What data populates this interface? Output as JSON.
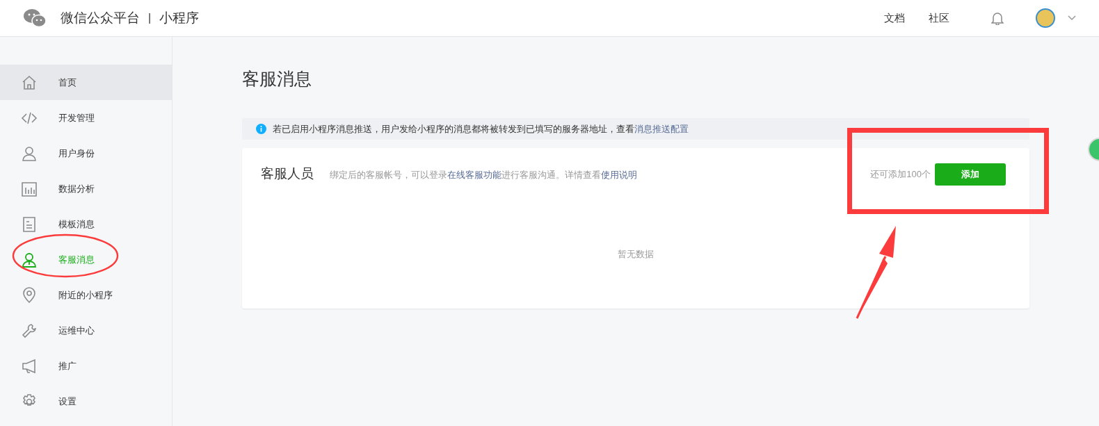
{
  "header": {
    "brand": "微信公众平台",
    "separator": "|",
    "product": "小程序",
    "links": [
      "文档",
      "社区"
    ]
  },
  "sidebar": {
    "items": [
      {
        "kind": "home",
        "label": "首页",
        "selected": false,
        "highlighted": true
      },
      {
        "kind": "code",
        "label": "开发管理",
        "selected": false,
        "highlighted": false
      },
      {
        "kind": "user",
        "label": "用户身份",
        "selected": false,
        "highlighted": false
      },
      {
        "kind": "chart",
        "label": "数据分析",
        "selected": false,
        "highlighted": false
      },
      {
        "kind": "doc",
        "label": "模板消息",
        "selected": false,
        "highlighted": false
      },
      {
        "kind": "service",
        "label": "客服消息",
        "selected": true,
        "highlighted": false
      },
      {
        "kind": "pin",
        "label": "附近的小程序",
        "selected": false,
        "highlighted": false
      },
      {
        "kind": "wrench",
        "label": "运维中心",
        "selected": false,
        "highlighted": false
      },
      {
        "kind": "megaphone",
        "label": "推广",
        "selected": false,
        "highlighted": false
      },
      {
        "kind": "gear",
        "label": "设置",
        "selected": false,
        "highlighted": false
      }
    ]
  },
  "page_title": "客服消息",
  "notice": {
    "text": "若已启用小程序消息推送，用户发给小程序的消息都将被转发到已填写的服务器地址，查看",
    "link": "消息推送配置"
  },
  "card": {
    "title": "客服人员",
    "description": "绑定后的客服帐号，可以登录",
    "link1": "在线客服功能",
    "description2": "进行客服沟通。详情查看",
    "link2": "使用说明",
    "remaining": "还可添加100个",
    "button": "添加",
    "empty": "暂无数据"
  }
}
